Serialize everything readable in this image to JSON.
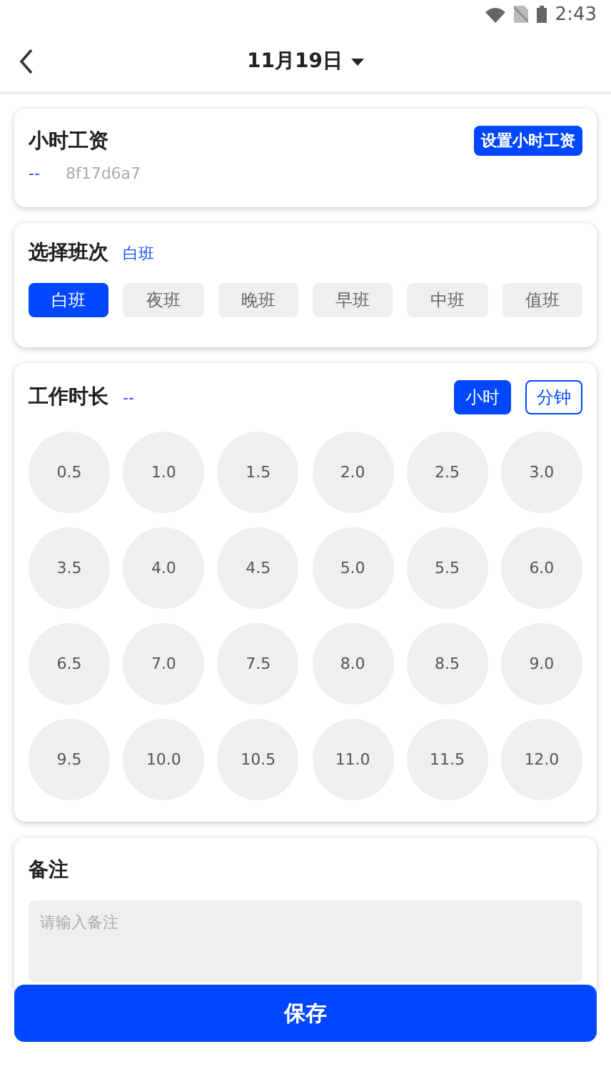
{
  "status_bar": {
    "time": "2:43"
  },
  "header": {
    "title": "11月19日"
  },
  "hourly_wage": {
    "title": "小时工资",
    "button": "设置小时工资",
    "value": "--",
    "code": "8f17d6a7"
  },
  "shift": {
    "title": "选择班次",
    "current": "白班",
    "options": [
      {
        "label": "白班",
        "selected": true
      },
      {
        "label": "夜班",
        "selected": false
      },
      {
        "label": "晚班",
        "selected": false
      },
      {
        "label": "早班",
        "selected": false
      },
      {
        "label": "中班",
        "selected": false
      },
      {
        "label": "值班",
        "selected": false
      }
    ]
  },
  "duration": {
    "title": "工作时长",
    "value": "--",
    "units": [
      {
        "label": "小时",
        "selected": true
      },
      {
        "label": "分钟",
        "selected": false
      }
    ],
    "options": [
      {
        "label": "0.5",
        "selected": false
      },
      {
        "label": "1.0",
        "selected": false
      },
      {
        "label": "1.5",
        "selected": false
      },
      {
        "label": "2.0",
        "selected": false
      },
      {
        "label": "2.5",
        "selected": false
      },
      {
        "label": "3.0",
        "selected": false
      },
      {
        "label": "3.5",
        "selected": false
      },
      {
        "label": "4.0",
        "selected": false
      },
      {
        "label": "4.5",
        "selected": false
      },
      {
        "label": "5.0",
        "selected": false
      },
      {
        "label": "5.5",
        "selected": false
      },
      {
        "label": "6.0",
        "selected": false
      },
      {
        "label": "6.5",
        "selected": false
      },
      {
        "label": "7.0",
        "selected": false
      },
      {
        "label": "7.5",
        "selected": false
      },
      {
        "label": "8.0",
        "selected": false
      },
      {
        "label": "8.5",
        "selected": false
      },
      {
        "label": "9.0",
        "selected": false
      },
      {
        "label": "9.5",
        "selected": false
      },
      {
        "label": "10.0",
        "selected": false
      },
      {
        "label": "10.5",
        "selected": false
      },
      {
        "label": "11.0",
        "selected": false
      },
      {
        "label": "11.5",
        "selected": false
      },
      {
        "label": "12.0",
        "selected": false
      }
    ]
  },
  "note": {
    "title": "备注",
    "placeholder": "请输入备注"
  },
  "save_button": "保存"
}
